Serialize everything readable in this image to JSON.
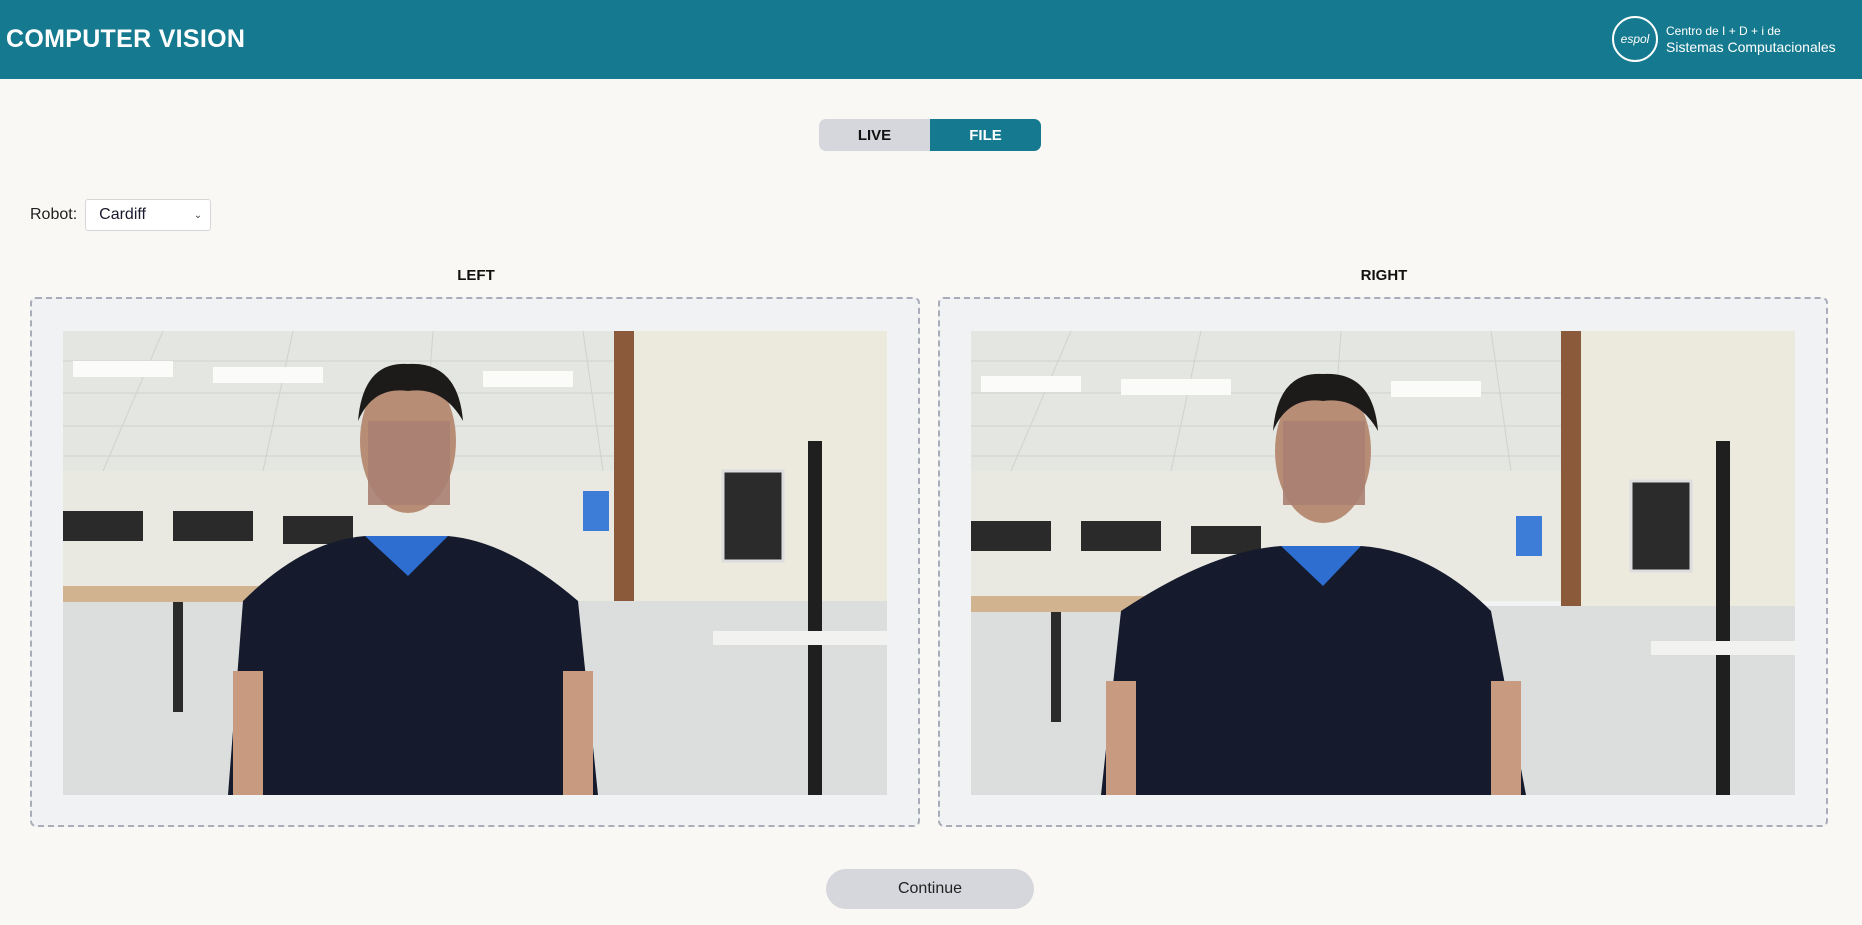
{
  "header": {
    "title": "COMPUTER VISION",
    "brand_logo_text": "espol",
    "brand_line1": "Centro de I + D + i de",
    "brand_line2": "Sistemas Computacionales"
  },
  "mode_toggle": {
    "options": [
      "LIVE",
      "FILE"
    ],
    "selected": "FILE"
  },
  "robot": {
    "label": "Robot:",
    "selected": "Cardiff"
  },
  "cameras": {
    "left_title": "LEFT",
    "right_title": "RIGHT"
  },
  "actions": {
    "continue_label": "Continue"
  },
  "colors": {
    "primary": "#157a8f",
    "background": "#f9f8f4",
    "toggle_inactive": "#d5d7dc"
  }
}
